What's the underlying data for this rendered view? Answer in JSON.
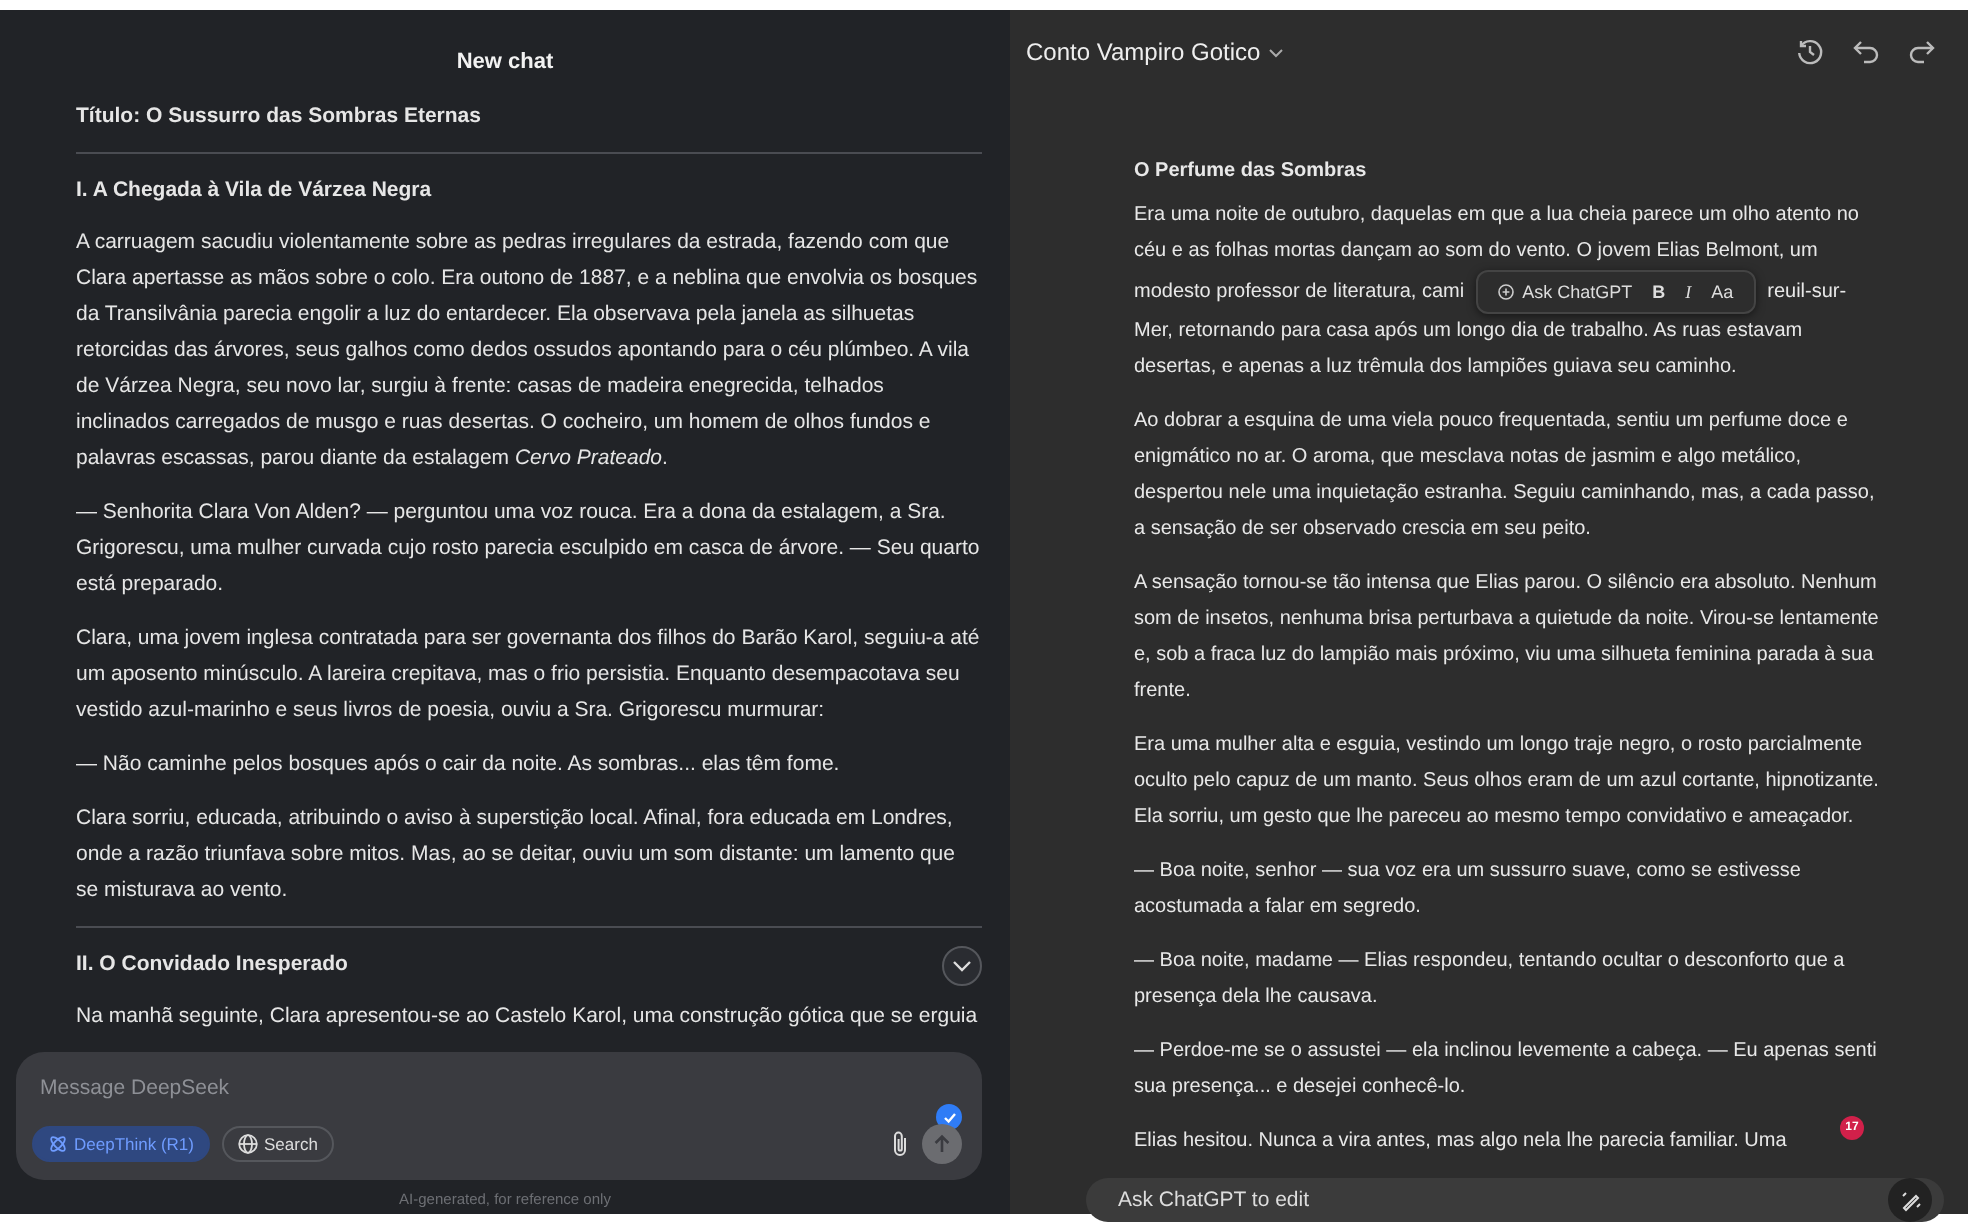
{
  "left_panel": {
    "title": "New chat",
    "blocks": [
      {
        "kind": "title",
        "text": "Título: O Sussurro das Sombras Eternas"
      },
      {
        "kind": "rule"
      },
      {
        "kind": "heading",
        "text": "I. A Chegada à Vila de Várzea Negra"
      },
      {
        "kind": "paragraph",
        "text": "A carruagem sacudiu violentamente sobre as pedras irregulares da estrada, fazendo com que Clara apertasse as mãos sobre o colo. Era outono de 1887, e a neblina que envolvia os bosques da Transilvânia parecia engolir a luz do entardecer. Ela observava pela janela as silhuetas retorcidas das árvores, seus galhos como dedos ossudos apontando para o céu plúmbeo. A vila de Várzea Negra, seu novo lar, surgiu à frente: casas de madeira enegrecida, telhados inclinados carregados de musgo e ruas desertas. O cocheiro, um homem de olhos fundos e palavras escassas, parou diante da estalagem *Cervo Prateado*."
      },
      {
        "kind": "paragraph",
        "text": "— Senhorita Clara Von Alden? — perguntou uma voz rouca. Era a dona da estalagem, a Sra. Grigorescu, uma mulher curvada cujo rosto parecia esculpido em casca de árvore. — Seu quarto está preparado."
      },
      {
        "kind": "paragraph",
        "text": "Clara, uma jovem inglesa contratada para ser governanta dos filhos do Barão Karol, seguiu-a até um aposento minúsculo. A lareira crepitava, mas o frio persistia. Enquanto desempacotava seu vestido azul-marinho e seus livros de poesia, ouviu a Sra. Grigorescu murmurar:"
      },
      {
        "kind": "paragraph",
        "text": "— Não caminhe pelos bosques após o cair da noite. As sombras... elas têm fome."
      },
      {
        "kind": "paragraph",
        "text": "Clara sorriu, educada, atribuindo o aviso à superstição local. Afinal, fora educada em Londres, onde a razão triunfava sobre mitos. Mas, ao se deitar, ouviu um som distante: um lamento que se misturava ao vento."
      },
      {
        "kind": "rule"
      },
      {
        "kind": "heading",
        "text": "II. O Convidado Inesperado"
      },
      {
        "kind": "paragraph",
        "text": "Na manhã seguinte, Clara apresentou-se ao Castelo Karol, uma construção gótica que se erguia"
      }
    ],
    "composer": {
      "placeholder": "Message DeepSeek",
      "checked": true,
      "toggles": [
        {
          "label": "DeepThink (R1)",
          "selected": true
        },
        {
          "label": "Search",
          "selected": false
        }
      ],
      "send_disabled": true
    },
    "footer": "AI-generated, for reference only"
  },
  "right_panel": {
    "title": "Conto Vampiro Gotico",
    "heading": "O Perfume das Sombras",
    "first_paragraph": {
      "lines_before": [
        "Era uma noite de outubro, daquelas em que a lua cheia parece um olho atento no",
        "céu e as folhas mortas dançam ao som do vento. O jovem Elias Belmont, um"
      ],
      "split_left": "modesto professor de literatura, cami",
      "split_right": "reuil-sur-",
      "lines_after": [
        "Mer, retornando para casa após um longo dia de trabalho. As ruas estavam",
        "desertas, e apenas a luz trêmula dos lampiões guiava seu caminho."
      ]
    },
    "toolbar": {
      "ask": "Ask ChatGPT",
      "buttons": [
        {
          "label": "B",
          "kind": "bold"
        },
        {
          "label": "I",
          "kind": "italic"
        },
        {
          "label": "Aa",
          "kind": "case"
        }
      ]
    },
    "paragraphs": [
      "Ao dobrar a esquina de uma viela pouco frequentada, sentiu um perfume doce e enigmático no ar. O aroma, que mesclava notas de jasmim e algo metálico, despertou nele uma inquietação estranha. Seguiu caminhando, mas, a cada passo, a sensação de ser observado crescia em seu peito.",
      "A sensação tornou-se tão intensa que Elias parou. O silêncio era absoluto. Nenhum som de insetos, nenhuma brisa perturbava a quietude da noite. Virou-se lentamente e, sob a fraca luz do lampião mais próximo, viu uma silhueta feminina parada à sua frente.",
      "Era uma mulher alta e esguia, vestindo um longo traje negro, o rosto parcialmente oculto pelo capuz de um manto. Seus olhos eram de um azul cortante, hipnotizante. Ela sorriu, um gesto que lhe pareceu ao mesmo tempo convidativo e ameaçador.",
      "— Boa noite, senhor — sua voz era um sussurro suave, como se estivesse acostumada a falar em segredo.",
      "— Boa noite, madame — Elias respondeu, tentando ocultar o desconforto que a presença dela lhe causava.",
      "— Perdoe-me se o assustei — ela inclinou levemente a cabeça. — Eu apenas senti sua presença... e desejei conhecê-lo.",
      "Elias hesitou. Nunca a vira antes, mas algo nela lhe parecia familiar. Uma"
    ],
    "badge": "17",
    "edit_placeholder": "Ask ChatGPT to edit"
  }
}
